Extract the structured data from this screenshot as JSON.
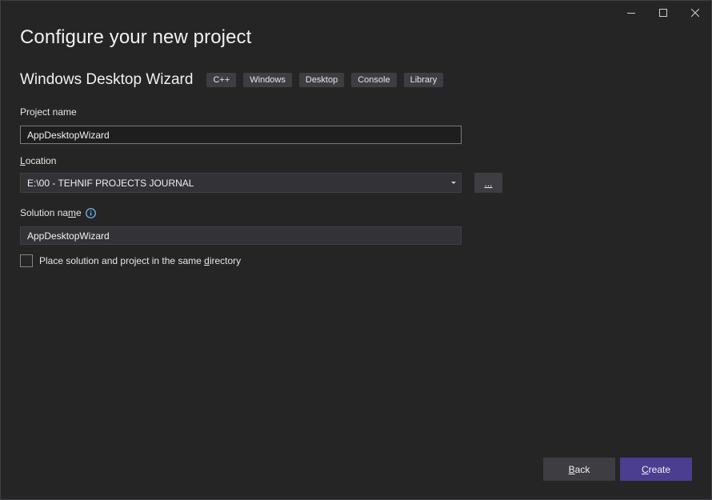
{
  "window": {
    "controls": {
      "minimize_icon": "minimize-icon",
      "maximize_icon": "maximize-icon",
      "close_icon": "close-icon"
    }
  },
  "header": {
    "title": "Configure your new project"
  },
  "template": {
    "name": "Windows Desktop Wizard",
    "tags": [
      "C++",
      "Windows",
      "Desktop",
      "Console",
      "Library"
    ]
  },
  "form": {
    "project_name": {
      "label": "Project name",
      "value": "AppDesktopWizard"
    },
    "location": {
      "label_underlined": "L",
      "label_rest": "ocation",
      "value": "E:\\00 - TEHNIF PROJECTS JOURNAL",
      "browse_label": "..."
    },
    "solution_name": {
      "label_pre": "Solution na",
      "label_underlined": "m",
      "label_post": "e",
      "value": "AppDesktopWizard",
      "info_icon": "info-icon"
    },
    "same_directory": {
      "label_pre": "Place solution and project in the same ",
      "label_underlined": "d",
      "label_post": "irectory",
      "checked": false
    }
  },
  "footer": {
    "back_underlined": "B",
    "back_rest": "ack",
    "create_underlined": "C",
    "create_rest": "reate"
  },
  "colors": {
    "background": "#252526",
    "accent": "#4b3d8f",
    "button": "#3e3e42",
    "info_icon": "#75beff"
  }
}
